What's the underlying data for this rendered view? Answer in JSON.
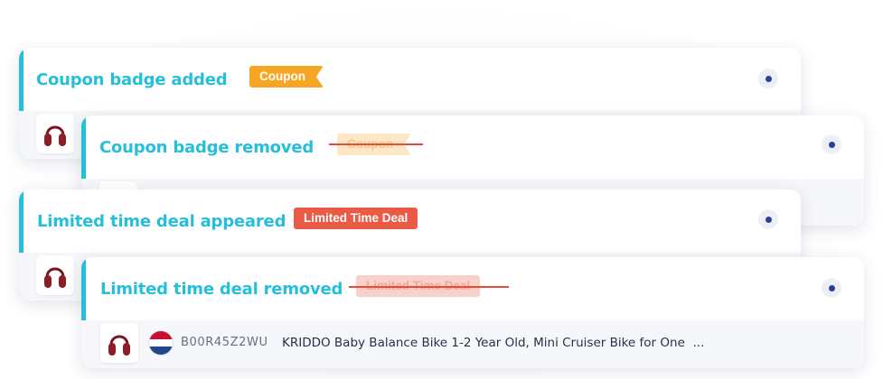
{
  "cards": [
    {
      "title": "Coupon badge added",
      "badge": "Coupon",
      "badge_state": "added"
    },
    {
      "title": "Coupon badge removed",
      "badge": "Coupon",
      "badge_state": "removed"
    },
    {
      "title": "Limited time deal appeared",
      "badge": "Limited Time Deal",
      "badge_state": "added"
    },
    {
      "title": "Limited time deal removed",
      "badge": "Limited Time Deal",
      "badge_state": "removed"
    }
  ],
  "product": {
    "icon": "red-headphones-thumbnail",
    "marketplace_flag": "netherlands-flag-icon",
    "asin": "B00R45Z2WU",
    "name": "KRIDDO Baby Balance Bike 1-2 Year Old, Mini Cruiser Bike for One",
    "ellipsis": "..."
  },
  "colors": {
    "accent": "#25bfdc",
    "coupon_badge": "#f7a623",
    "deal_badge": "#ea5b45",
    "strike": "#e84a3b",
    "status_dot": "#2a3f99"
  }
}
